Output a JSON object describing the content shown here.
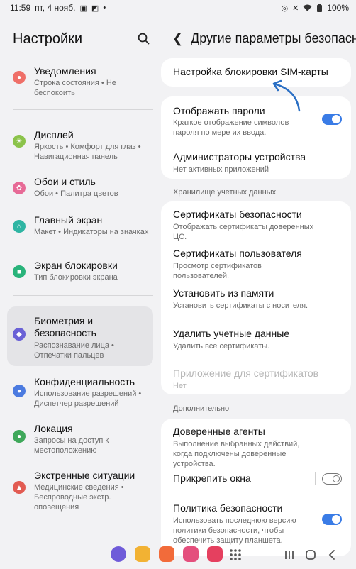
{
  "status": {
    "time": "11:59",
    "date": "пт, 4 нояб.",
    "battery": "100%"
  },
  "left": {
    "title": "Настройки",
    "items": [
      {
        "title": "Уведомления",
        "sub": "Строка состояния • Не беспокоить",
        "icon": "bell-icon",
        "color": "#ef6f68"
      },
      {
        "title": "Дисплей",
        "sub": "Яркость • Комфорт для глаз • Навигационная панель",
        "icon": "sun-icon",
        "color": "#8bc34a"
      },
      {
        "title": "Обои и стиль",
        "sub": "Обои • Палитра цветов",
        "icon": "palette-icon",
        "color": "#e76a96"
      },
      {
        "title": "Главный экран",
        "sub": "Макет • Индикаторы на значках",
        "icon": "home-icon",
        "color": "#2fb5a3"
      },
      {
        "title": "Экран блокировки",
        "sub": "Тип блокировки экрана",
        "icon": "lock-icon",
        "color": "#29b37a"
      },
      {
        "title": "Биометрия и безопасность",
        "sub": "Распознавание лица • Отпечатки пальцев",
        "icon": "shield-icon",
        "color": "#6a61d6"
      },
      {
        "title": "Конфиденциальность",
        "sub": "Использование разрешений • Диспетчер разрешений",
        "icon": "privacy-icon",
        "color": "#4c7be0"
      },
      {
        "title": "Локация",
        "sub": "Запросы на доступ к местоположению",
        "icon": "location-icon",
        "color": "#3fa85a"
      },
      {
        "title": "Экстренные ситуации",
        "sub": "Медицинские сведения • Беспроводные экстр. оповещения",
        "icon": "emergency-icon",
        "color": "#e25b52"
      }
    ]
  },
  "right": {
    "title": "Другие параметры безопасности",
    "sim_lock": "Настройка блокировки SIM-карты",
    "show_passwords": {
      "title": "Отображать пароли",
      "sub": "Краткое отображение символов пароля по мере их ввода."
    },
    "device_admins": {
      "title": "Администраторы устройства",
      "sub": "Нет активных приложений"
    },
    "section_credentials": "Хранилище учетных данных",
    "security_certs": {
      "title": "Сертификаты безопасности",
      "sub": "Отображать сертификаты доверенных ЦС."
    },
    "user_certs": {
      "title": "Сертификаты пользователя",
      "sub": "Просмотр сертификатов пользователей."
    },
    "install_from_storage": {
      "title": "Установить из памяти",
      "sub": "Установить сертификаты с носителя."
    },
    "clear_credentials": {
      "title": "Удалить учетные данные",
      "sub": "Удалить все сертификаты."
    },
    "cert_app": {
      "title": "Приложение для сертификатов",
      "sub": "Нет"
    },
    "section_additional": "Дополнительно",
    "trust_agents": {
      "title": "Доверенные агенты",
      "sub": "Выполнение выбранных действий, когда подключены доверенные устройства."
    },
    "pin_windows": {
      "title": "Прикрепить окна"
    },
    "security_policy": {
      "title": "Политика безопасности",
      "sub": "Использовать последнюю версию политики безопасности, чтобы обеспечить защиту планшета."
    }
  },
  "colors": {
    "accent": "#3a7ce6"
  }
}
